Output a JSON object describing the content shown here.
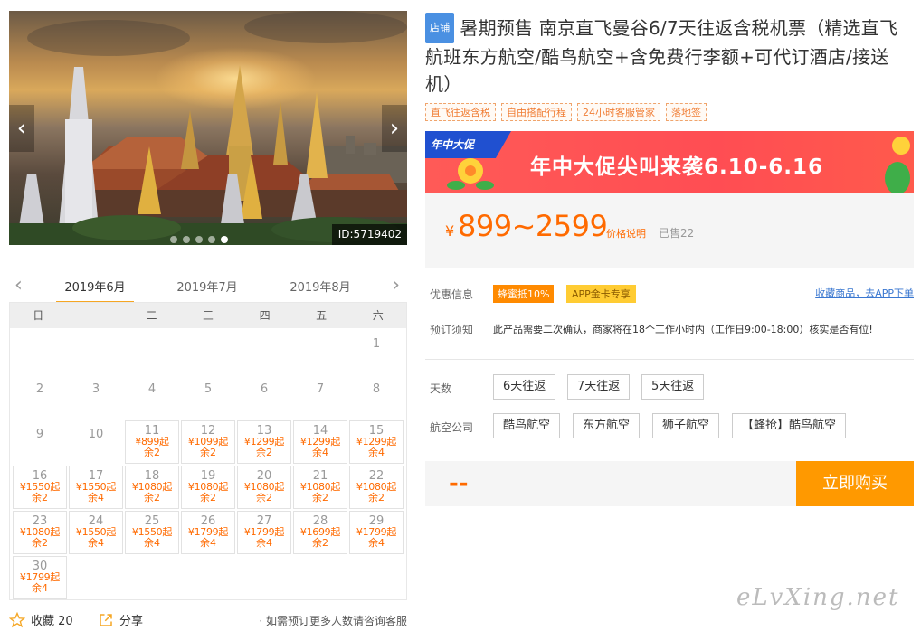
{
  "hero": {
    "id_label": "ID:5719402",
    "prev_icon": "chevron-left-icon",
    "next_icon": "chevron-right-icon",
    "slide_count": 5,
    "active_slide": 4
  },
  "calendar": {
    "months": [
      "2019年6月",
      "2019年7月",
      "2019年8月"
    ],
    "active_month": 0,
    "weekdays": [
      "日",
      "一",
      "二",
      "三",
      "四",
      "五",
      "六"
    ],
    "days": [
      {
        "day": "1",
        "col": 6,
        "row": 0
      },
      {
        "day": "2",
        "col": 0,
        "row": 1
      },
      {
        "day": "3",
        "col": 1,
        "row": 1
      },
      {
        "day": "4",
        "col": 2,
        "row": 1
      },
      {
        "day": "5",
        "col": 3,
        "row": 1
      },
      {
        "day": "6",
        "col": 4,
        "row": 1
      },
      {
        "day": "7",
        "col": 5,
        "row": 1
      },
      {
        "day": "8",
        "col": 6,
        "row": 1
      },
      {
        "day": "9",
        "col": 0,
        "row": 2
      },
      {
        "day": "10",
        "col": 1,
        "row": 2
      },
      {
        "day": "11",
        "col": 2,
        "row": 2,
        "price": "¥899起",
        "stock": "余2"
      },
      {
        "day": "12",
        "col": 3,
        "row": 2,
        "price": "¥1099起",
        "stock": "余2"
      },
      {
        "day": "13",
        "col": 4,
        "row": 2,
        "price": "¥1299起",
        "stock": "余2"
      },
      {
        "day": "14",
        "col": 5,
        "row": 2,
        "price": "¥1299起",
        "stock": "余4"
      },
      {
        "day": "15",
        "col": 6,
        "row": 2,
        "price": "¥1299起",
        "stock": "余4"
      },
      {
        "day": "16",
        "col": 0,
        "row": 3,
        "price": "¥1550起",
        "stock": "余2"
      },
      {
        "day": "17",
        "col": 1,
        "row": 3,
        "price": "¥1550起",
        "stock": "余4"
      },
      {
        "day": "18",
        "col": 2,
        "row": 3,
        "price": "¥1080起",
        "stock": "余2"
      },
      {
        "day": "19",
        "col": 3,
        "row": 3,
        "price": "¥1080起",
        "stock": "余2"
      },
      {
        "day": "20",
        "col": 4,
        "row": 3,
        "price": "¥1080起",
        "stock": "余2"
      },
      {
        "day": "21",
        "col": 5,
        "row": 3,
        "price": "¥1080起",
        "stock": "余2"
      },
      {
        "day": "22",
        "col": 6,
        "row": 3,
        "price": "¥1080起",
        "stock": "余2"
      },
      {
        "day": "23",
        "col": 0,
        "row": 4,
        "price": "¥1080起",
        "stock": "余2"
      },
      {
        "day": "24",
        "col": 1,
        "row": 4,
        "price": "¥1550起",
        "stock": "余4"
      },
      {
        "day": "25",
        "col": 2,
        "row": 4,
        "price": "¥1550起",
        "stock": "余4"
      },
      {
        "day": "26",
        "col": 3,
        "row": 4,
        "price": "¥1799起",
        "stock": "余4"
      },
      {
        "day": "27",
        "col": 4,
        "row": 4,
        "price": "¥1799起",
        "stock": "余4"
      },
      {
        "day": "28",
        "col": 5,
        "row": 4,
        "price": "¥1699起",
        "stock": "余2"
      },
      {
        "day": "29",
        "col": 6,
        "row": 4,
        "price": "¥1799起",
        "stock": "余4"
      },
      {
        "day": "30",
        "col": 0,
        "row": 5,
        "price": "¥1799起",
        "stock": "余4"
      }
    ]
  },
  "bottom": {
    "fav_label": "收藏 20",
    "share_label": "分享",
    "hint": "· 如需预订更多人数请咨询客服"
  },
  "product": {
    "shop_badge": "店铺",
    "title": "暑期预售 南京直飞曼谷6/7天往返含税机票（精选直飞航班东方航空/酷鸟航空+含免费行李额+可代订酒店/接送机）",
    "tags": [
      "直飞往返含税",
      "自由搭配行程",
      "24小时客服管家",
      "落地签"
    ]
  },
  "banner": {
    "corner": "年中大促",
    "text": "年中大促尖叫来袭6.10-6.16"
  },
  "price": {
    "currency": "¥",
    "amount": "899~2599",
    "note": "价格说明",
    "sold": "已售22"
  },
  "promo": {
    "label": "优惠信息",
    "badge1": "蜂蜜抵10%",
    "badge2": "APP金卡专享",
    "fav_link": "收藏商品，去APP下单"
  },
  "booking": {
    "label": "预订须知",
    "text": "此产品需要二次确认，商家将在18个工作小时内（工作日9:00-18:00）核实是否有位!"
  },
  "days_option": {
    "label": "天数",
    "options": [
      "6天往返",
      "7天往返",
      "5天往返"
    ]
  },
  "airline_option": {
    "label": "航空公司",
    "options": [
      "酷鸟航空",
      "东方航空",
      "狮子航空",
      "【蜂抢】酷鸟航空"
    ]
  },
  "buy": {
    "price_placeholder": "--",
    "button": "立即购买"
  },
  "watermark": "eLvXing.net",
  "colors": {
    "accent": "#ff6a00",
    "buy": "#ff9900",
    "link": "#3a77d0",
    "badge": "#4a90e2"
  }
}
